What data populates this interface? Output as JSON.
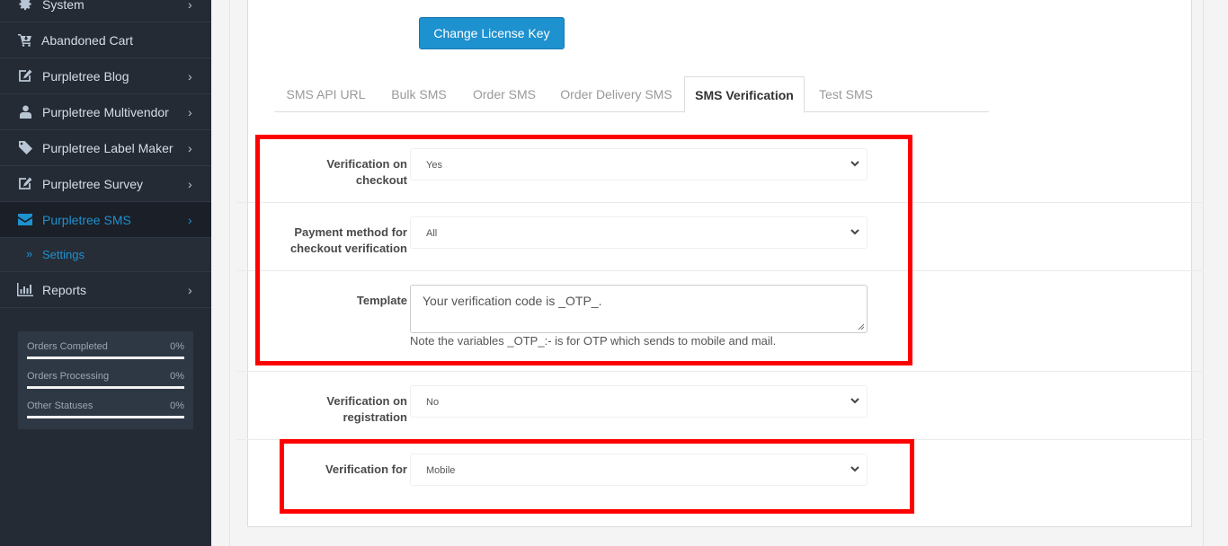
{
  "sidebar": {
    "items": [
      {
        "label": "System",
        "icon": "gear-icon",
        "has_children": true
      },
      {
        "label": "Abandoned Cart",
        "icon": "cart-icon",
        "has_children": false
      },
      {
        "label": "Purpletree Blog",
        "icon": "edit-icon",
        "has_children": true
      },
      {
        "label": "Purpletree Multivendor",
        "icon": "user-icon",
        "has_children": true
      },
      {
        "label": "Purpletree Label Maker",
        "icon": "tag-icon",
        "has_children": true
      },
      {
        "label": "Purpletree Survey",
        "icon": "edit-icon",
        "has_children": true
      },
      {
        "label": "Purpletree SMS",
        "icon": "envelope-icon",
        "has_children": true,
        "active": true
      },
      {
        "label": "Reports",
        "icon": "bar-chart-icon",
        "has_children": true
      }
    ],
    "subitem": {
      "label": "Settings",
      "icon": "double-chevron-right-icon"
    },
    "stats": [
      {
        "label": "Orders Completed",
        "value": "0%",
        "progress": 0
      },
      {
        "label": "Orders Processing",
        "value": "0%",
        "progress": 0
      },
      {
        "label": "Other Statuses",
        "value": "0%",
        "progress": 0
      }
    ]
  },
  "main": {
    "license_button": "Change License Key",
    "tabs": [
      {
        "label": "SMS API URL"
      },
      {
        "label": "Bulk SMS"
      },
      {
        "label": "Order SMS"
      },
      {
        "label": "Order Delivery SMS"
      },
      {
        "label": "SMS Verification",
        "active": true
      },
      {
        "label": "Test SMS"
      }
    ],
    "fields": {
      "checkout_verification": {
        "label_line1": "Verification on",
        "label_line2": "checkout",
        "value": "Yes"
      },
      "payment_method": {
        "label_line1": "Payment method for",
        "label_line2": "checkout verification",
        "value": "All"
      },
      "template": {
        "label": "Template",
        "value": "Your verification code is _OTP_.",
        "help": "Note the variables _OTP_:- is for OTP which sends to mobile and mail."
      },
      "registration_verification": {
        "label_line1": "Verification on",
        "label_line2": "registration",
        "value": "No"
      },
      "verification_for": {
        "label": "Verification for",
        "value": "Mobile"
      }
    }
  },
  "colors": {
    "accent": "#1e91cf",
    "sidebar_bg": "#242b35",
    "highlight": "#ff0000"
  }
}
